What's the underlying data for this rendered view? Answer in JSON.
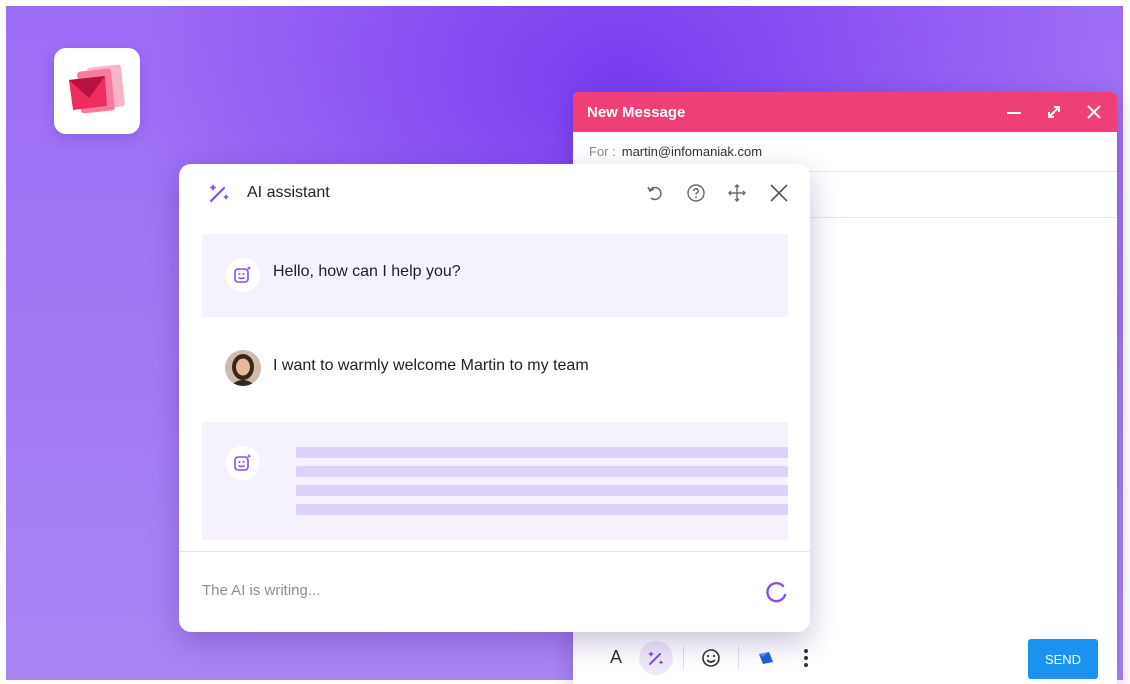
{
  "compose": {
    "title": "New Message",
    "to_label": "For :",
    "to_value": "martin@infomaniak.com",
    "send_label": "SEND",
    "toolbar": {
      "font_label": "A"
    }
  },
  "assistant": {
    "title": "AI assistant",
    "messages": [
      {
        "role": "bot",
        "text": "Hello, how can I help you?"
      },
      {
        "role": "user",
        "text": "I want to warmly welcome Martin to my team"
      }
    ],
    "status_text": "The AI is writing..."
  },
  "colors": {
    "accent_pink": "#ee3f76",
    "accent_purple": "#8b4de8",
    "send_blue": "#1a92f0"
  },
  "icons": [
    "app-logo-icon",
    "minimize-icon",
    "expand-icon",
    "close-icon",
    "magic-wand-icon",
    "undo-icon",
    "help-icon",
    "move-icon",
    "bot-icon",
    "spinner-icon",
    "emoji-icon",
    "drive-icon",
    "more-icon"
  ]
}
